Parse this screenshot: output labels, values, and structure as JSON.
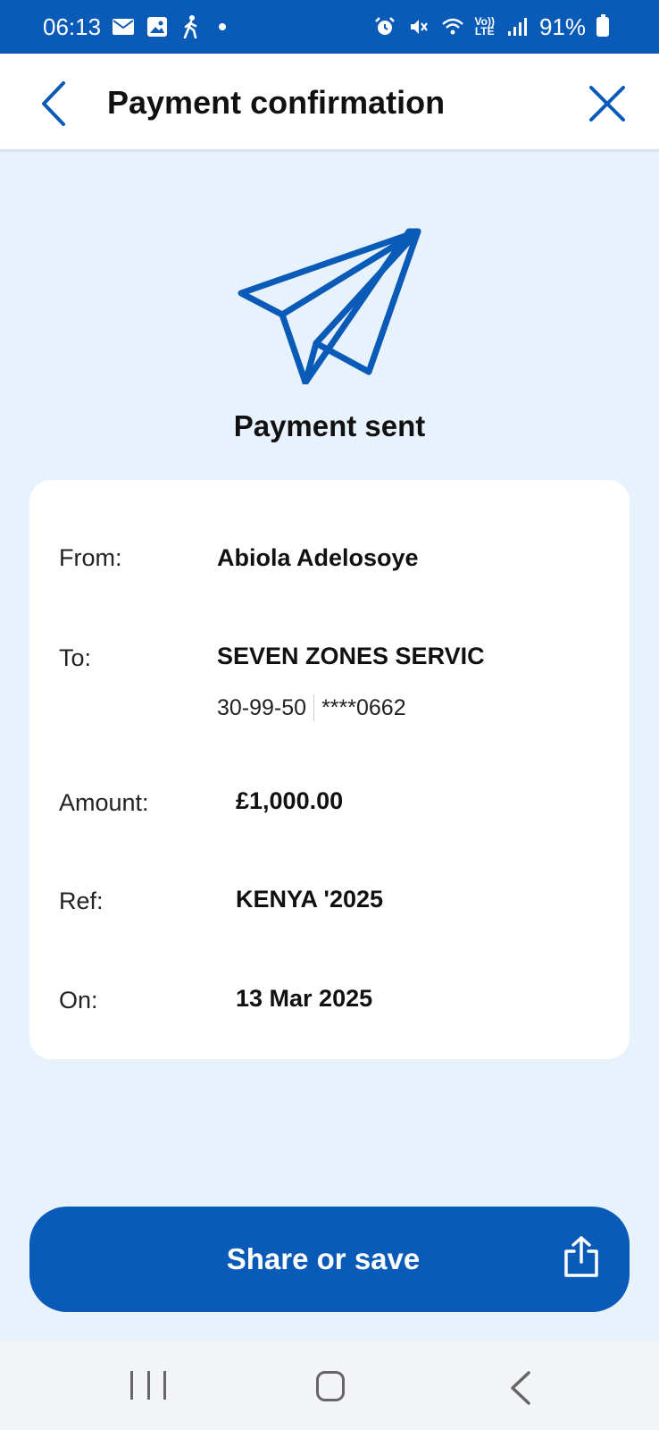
{
  "status_bar": {
    "time": "06:13",
    "battery": "91%",
    "lte_top": "Vo))",
    "lte_bottom": "LTE",
    "left_icons": [
      "mail-icon",
      "image-icon",
      "walking-icon",
      "dot"
    ],
    "right_icons": [
      "alarm-icon",
      "mute-icon",
      "wifi-icon",
      "volte-icon",
      "signal-icon",
      "battery-icon"
    ]
  },
  "header": {
    "title": "Payment confirmation",
    "back_icon": "chevron-left-icon",
    "close_icon": "close-icon"
  },
  "hero": {
    "icon": "paper-plane-icon",
    "title": "Payment sent"
  },
  "details": {
    "from_label": "From:",
    "from_value": "Abiola Adelosoye",
    "to_label": "To:",
    "to_value": "SEVEN ZONES SERVIC",
    "sort_code": "30-99-50",
    "account": "****0662",
    "amount_label": "Amount:",
    "amount_value": "£1,000.00",
    "ref_label": "Ref:",
    "ref_value": "KENYA '2025",
    "on_label": "On:",
    "on_value": "13 Mar 2025"
  },
  "actions": {
    "share_label": "Share or save",
    "share_icon": "share-icon"
  },
  "nav": {
    "items": [
      "recent-apps-icon",
      "home-icon",
      "back-icon"
    ]
  },
  "colors": {
    "primary": "#0a5bb8",
    "background": "#e8f2fd",
    "card": "#ffffff"
  }
}
